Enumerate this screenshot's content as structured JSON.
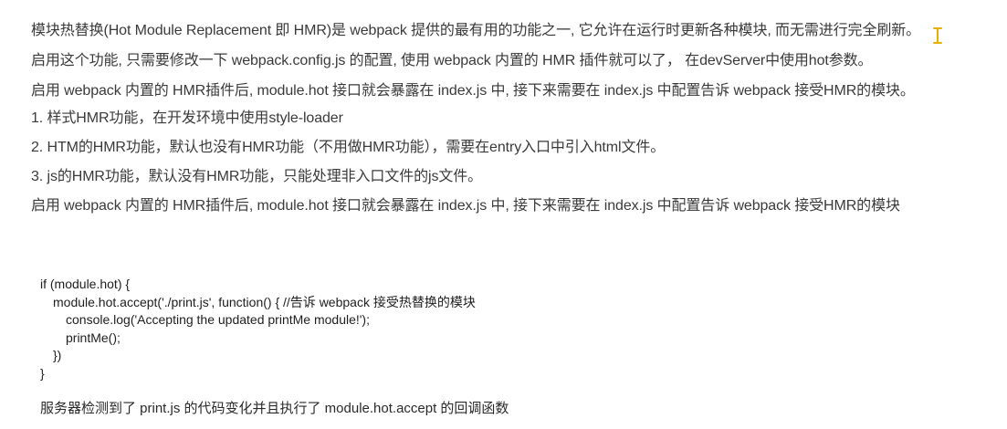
{
  "paragraphs": [
    "模块热替换(Hot Module Replacement 即 HMR)是 webpack 提供的最有用的功能之一, 它允许在运行时更新各种模块, 而无需进行完全刷新。",
    "启用这个功能, 只需要修改一下 webpack.config.js 的配置, 使用 webpack 内置的 HMR 插件就可以了，  在devServer中使用hot参数。",
    "启用 webpack 内置的 HMR插件后, module.hot 接口就会暴露在 index.js 中, 接下来需要在 index.js 中配置告诉 webpack 接受HMR的模块。",
    "1. 样式HMR功能，在开发环境中使用style-loader",
    "2. HTM的HMR功能，默认也没有HMR功能（不用做HMR功能），需要在entry入口中引入html文件。",
    "3. js的HMR功能，默认没有HMR功能，只能处理非入口文件的js文件。",
    "启用 webpack 内置的 HMR插件后, module.hot 接口就会暴露在 index.js 中, 接下来需要在 index.js 中配置告诉 webpack 接受HMR的模块"
  ],
  "code": [
    "if (module.hot) {",
    "module.hot.accept('./print.js', function() { //告诉 webpack 接受热替换的模块",
    "console.log('Accepting the updated printMe module!');",
    "printMe();",
    "})",
    "}"
  ],
  "note": "服务器检测到了 print.js 的代码变化并且执行了 module.hot.accept 的回调函数",
  "colors": {
    "cursor": "#e3b200"
  }
}
